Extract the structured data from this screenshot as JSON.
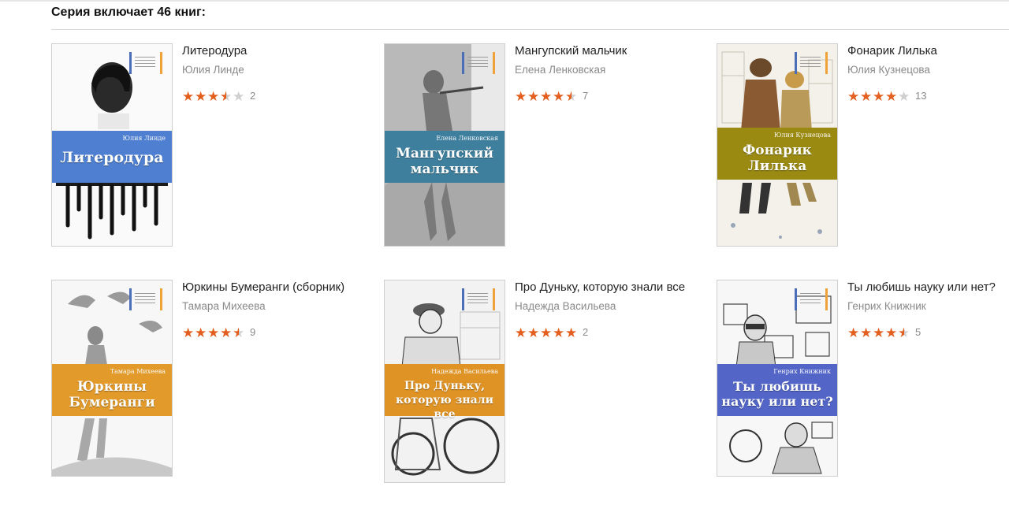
{
  "series_header": "Серия включает 46 книг:",
  "books": [
    {
      "title": "Литеродура",
      "author": "Юлия Линде",
      "rating": 3.5,
      "votes": "2",
      "cover": {
        "author": "Юлия Линде",
        "title": "Литеродура",
        "band_color": "#4f7fd0",
        "bg": "#fafafa"
      }
    },
    {
      "title": "Мангупский мальчик",
      "author": "Елена Ленковская",
      "rating": 4.5,
      "votes": "7",
      "cover": {
        "author": "Елена Ленковская",
        "title": "Мангупский мальчик",
        "band_color": "#3f7f9e",
        "bg": "#b9b9b9"
      }
    },
    {
      "title": "Фонарик Лилька",
      "author": "Юлия Кузнецова",
      "rating": 4,
      "votes": "13",
      "cover": {
        "author": "Юлия Кузнецова",
        "title": "Фонарик Лилька",
        "band_color": "#9a8a12",
        "bg": "#f3f1ea"
      }
    },
    {
      "title": "Юркины Бумеранги (сборник)",
      "author": "Тамара Михеева",
      "rating": 4.5,
      "votes": "9",
      "cover": {
        "author": "Тамара Михеева",
        "title": "Юркины Бумеранги",
        "band_color": "#e29a2b",
        "bg": "#f7f7f7"
      }
    },
    {
      "title": "Про Дуньку, которую знали все",
      "author": "Надежда Васильева",
      "rating": 5,
      "votes": "2",
      "cover": {
        "author": "Надежда Васильева",
        "title": "Про Дуньку, которую знали все",
        "band_color": "#df9325",
        "bg": "#f2f2f2"
      }
    },
    {
      "title": "Ты любишь науку или нет?",
      "author": "Генрих Книжник",
      "rating": 4.5,
      "votes": "5",
      "cover": {
        "author": "Генрих Книжник",
        "title": "Ты любишь науку или нет?",
        "band_color": "#5366c8",
        "bg": "#f7f7f7"
      }
    }
  ]
}
